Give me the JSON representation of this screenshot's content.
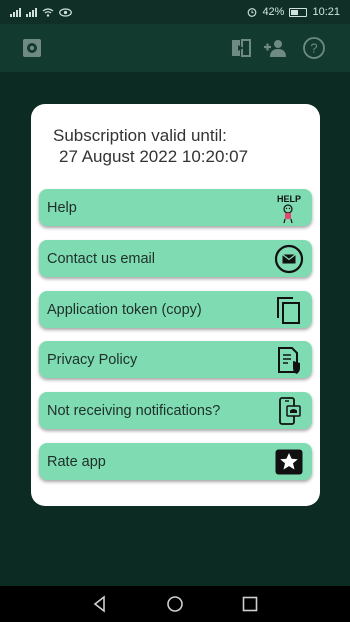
{
  "status_bar": {
    "battery": "42%",
    "time": "10:21"
  },
  "dialog": {
    "subscription_label": "Subscription valid until:",
    "subscription_date": "27 August 2022 10:20:07",
    "help_icon_text": "HELP",
    "items": [
      {
        "label": "Help",
        "icon": "help-icon"
      },
      {
        "label": "Contact us email",
        "icon": "email-icon"
      },
      {
        "label": "Application token (copy)",
        "icon": "copy-icon"
      },
      {
        "label": "Privacy Policy",
        "icon": "privacy-policy-icon"
      },
      {
        "label": "Not receiving notifications?",
        "icon": "phone-notification-icon"
      },
      {
        "label": "Rate app",
        "icon": "star-icon"
      }
    ]
  },
  "colors": {
    "background": "#0b2a22",
    "appbar": "#133a2f",
    "item_green": "#7fdcb2",
    "dialog": "#ffffff"
  }
}
